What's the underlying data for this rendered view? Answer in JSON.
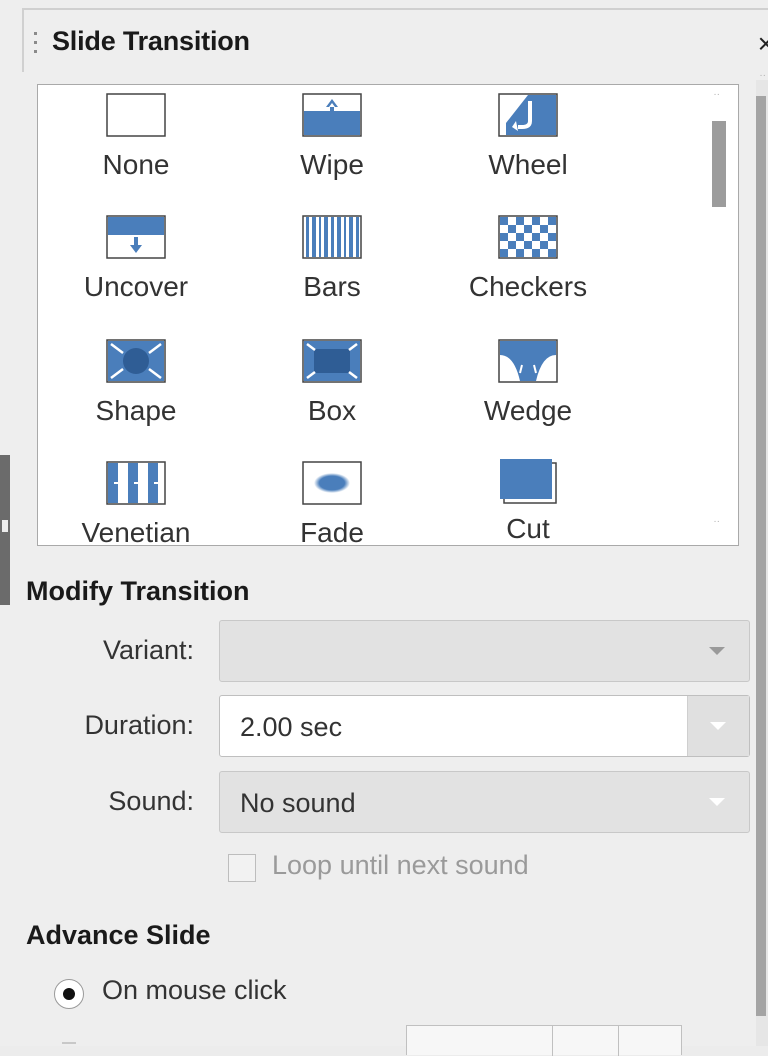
{
  "panel": {
    "title": "Slide Transition",
    "close_label": "×"
  },
  "transitions": [
    {
      "label": "None",
      "icon": "none-icon"
    },
    {
      "label": "Wipe",
      "icon": "wipe-icon"
    },
    {
      "label": "Wheel",
      "icon": "wheel-icon"
    },
    {
      "label": "Uncover",
      "icon": "uncover-icon"
    },
    {
      "label": "Bars",
      "icon": "bars-icon"
    },
    {
      "label": "Checkers",
      "icon": "checkers-icon"
    },
    {
      "label": "Shape",
      "icon": "shape-icon"
    },
    {
      "label": "Box",
      "icon": "box-icon"
    },
    {
      "label": "Wedge",
      "icon": "wedge-icon"
    },
    {
      "label": "Venetian",
      "icon": "venetian-icon"
    },
    {
      "label": "Fade",
      "icon": "fade-icon"
    },
    {
      "label": "Cut",
      "icon": "cut-icon"
    }
  ],
  "modify": {
    "heading": "Modify Transition",
    "variant_label": "Variant:",
    "variant_value": "",
    "duration_label": "Duration:",
    "duration_value": "2.00 sec",
    "sound_label": "Sound:",
    "sound_value": "No sound",
    "loop_label": "Loop until next sound",
    "loop_checked": false
  },
  "advance": {
    "heading": "Advance Slide",
    "on_mouse_click_label": "On mouse click",
    "on_mouse_click_selected": true
  },
  "colors": {
    "accent": "#4a7ebb",
    "panel_bg": "#eeeeee"
  }
}
